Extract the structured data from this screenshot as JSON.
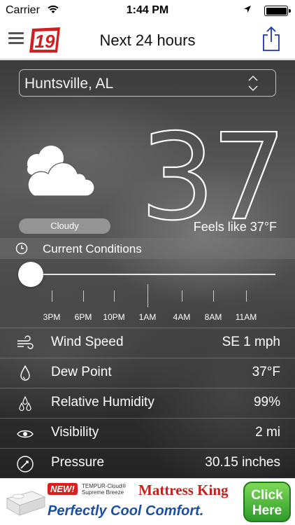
{
  "status_bar": {
    "carrier": "Carrier",
    "time": "1:44 PM",
    "icons": [
      "wifi-icon",
      "location-arrow-icon",
      "battery-icon"
    ]
  },
  "nav": {
    "title": "Next 24 hours",
    "logo_text": "19",
    "icons": [
      "hamburger-icon",
      "share-icon"
    ]
  },
  "location": {
    "value": "Huntsville, AL"
  },
  "current": {
    "condition": "Cloudy",
    "temperature": "37°",
    "feels_like": "Feels like 37°F",
    "condition_icon": "cloud-icon"
  },
  "conditions_header": {
    "label": "Current Conditions",
    "icon": "clock-icon"
  },
  "timeline": {
    "labels": [
      "3PM",
      "6PM",
      "10PM",
      "1AM",
      "4AM",
      "8AM",
      "11AM"
    ],
    "slider_position": 0
  },
  "details": [
    {
      "icon": "wind-icon",
      "label": "Wind Speed",
      "value": "SE 1 mph"
    },
    {
      "icon": "dew-drop-icon",
      "label": "Dew Point",
      "value": "37°F"
    },
    {
      "icon": "humidity-icon",
      "label": "Relative Humidity",
      "value": "99%"
    },
    {
      "icon": "eye-icon",
      "label": "Visibility",
      "value": "2 mi"
    },
    {
      "icon": "pressure-gauge-icon",
      "label": "Pressure",
      "value": "30.15 inches"
    }
  ],
  "ad": {
    "badge": "NEW!",
    "product_line": "TEMPUR-Cloud® Supreme Breeze",
    "brand": "Mattress King",
    "tagline": "Perfectly Cool Comfort.",
    "cta_line1": "Click",
    "cta_line2": "Here"
  },
  "colors": {
    "logo_red": "#d11f1f",
    "share_blue": "#1a35b8",
    "ad_red": "#c8201e",
    "ad_blue": "#1b4fa2",
    "ad_green": "#2d9b2a"
  }
}
